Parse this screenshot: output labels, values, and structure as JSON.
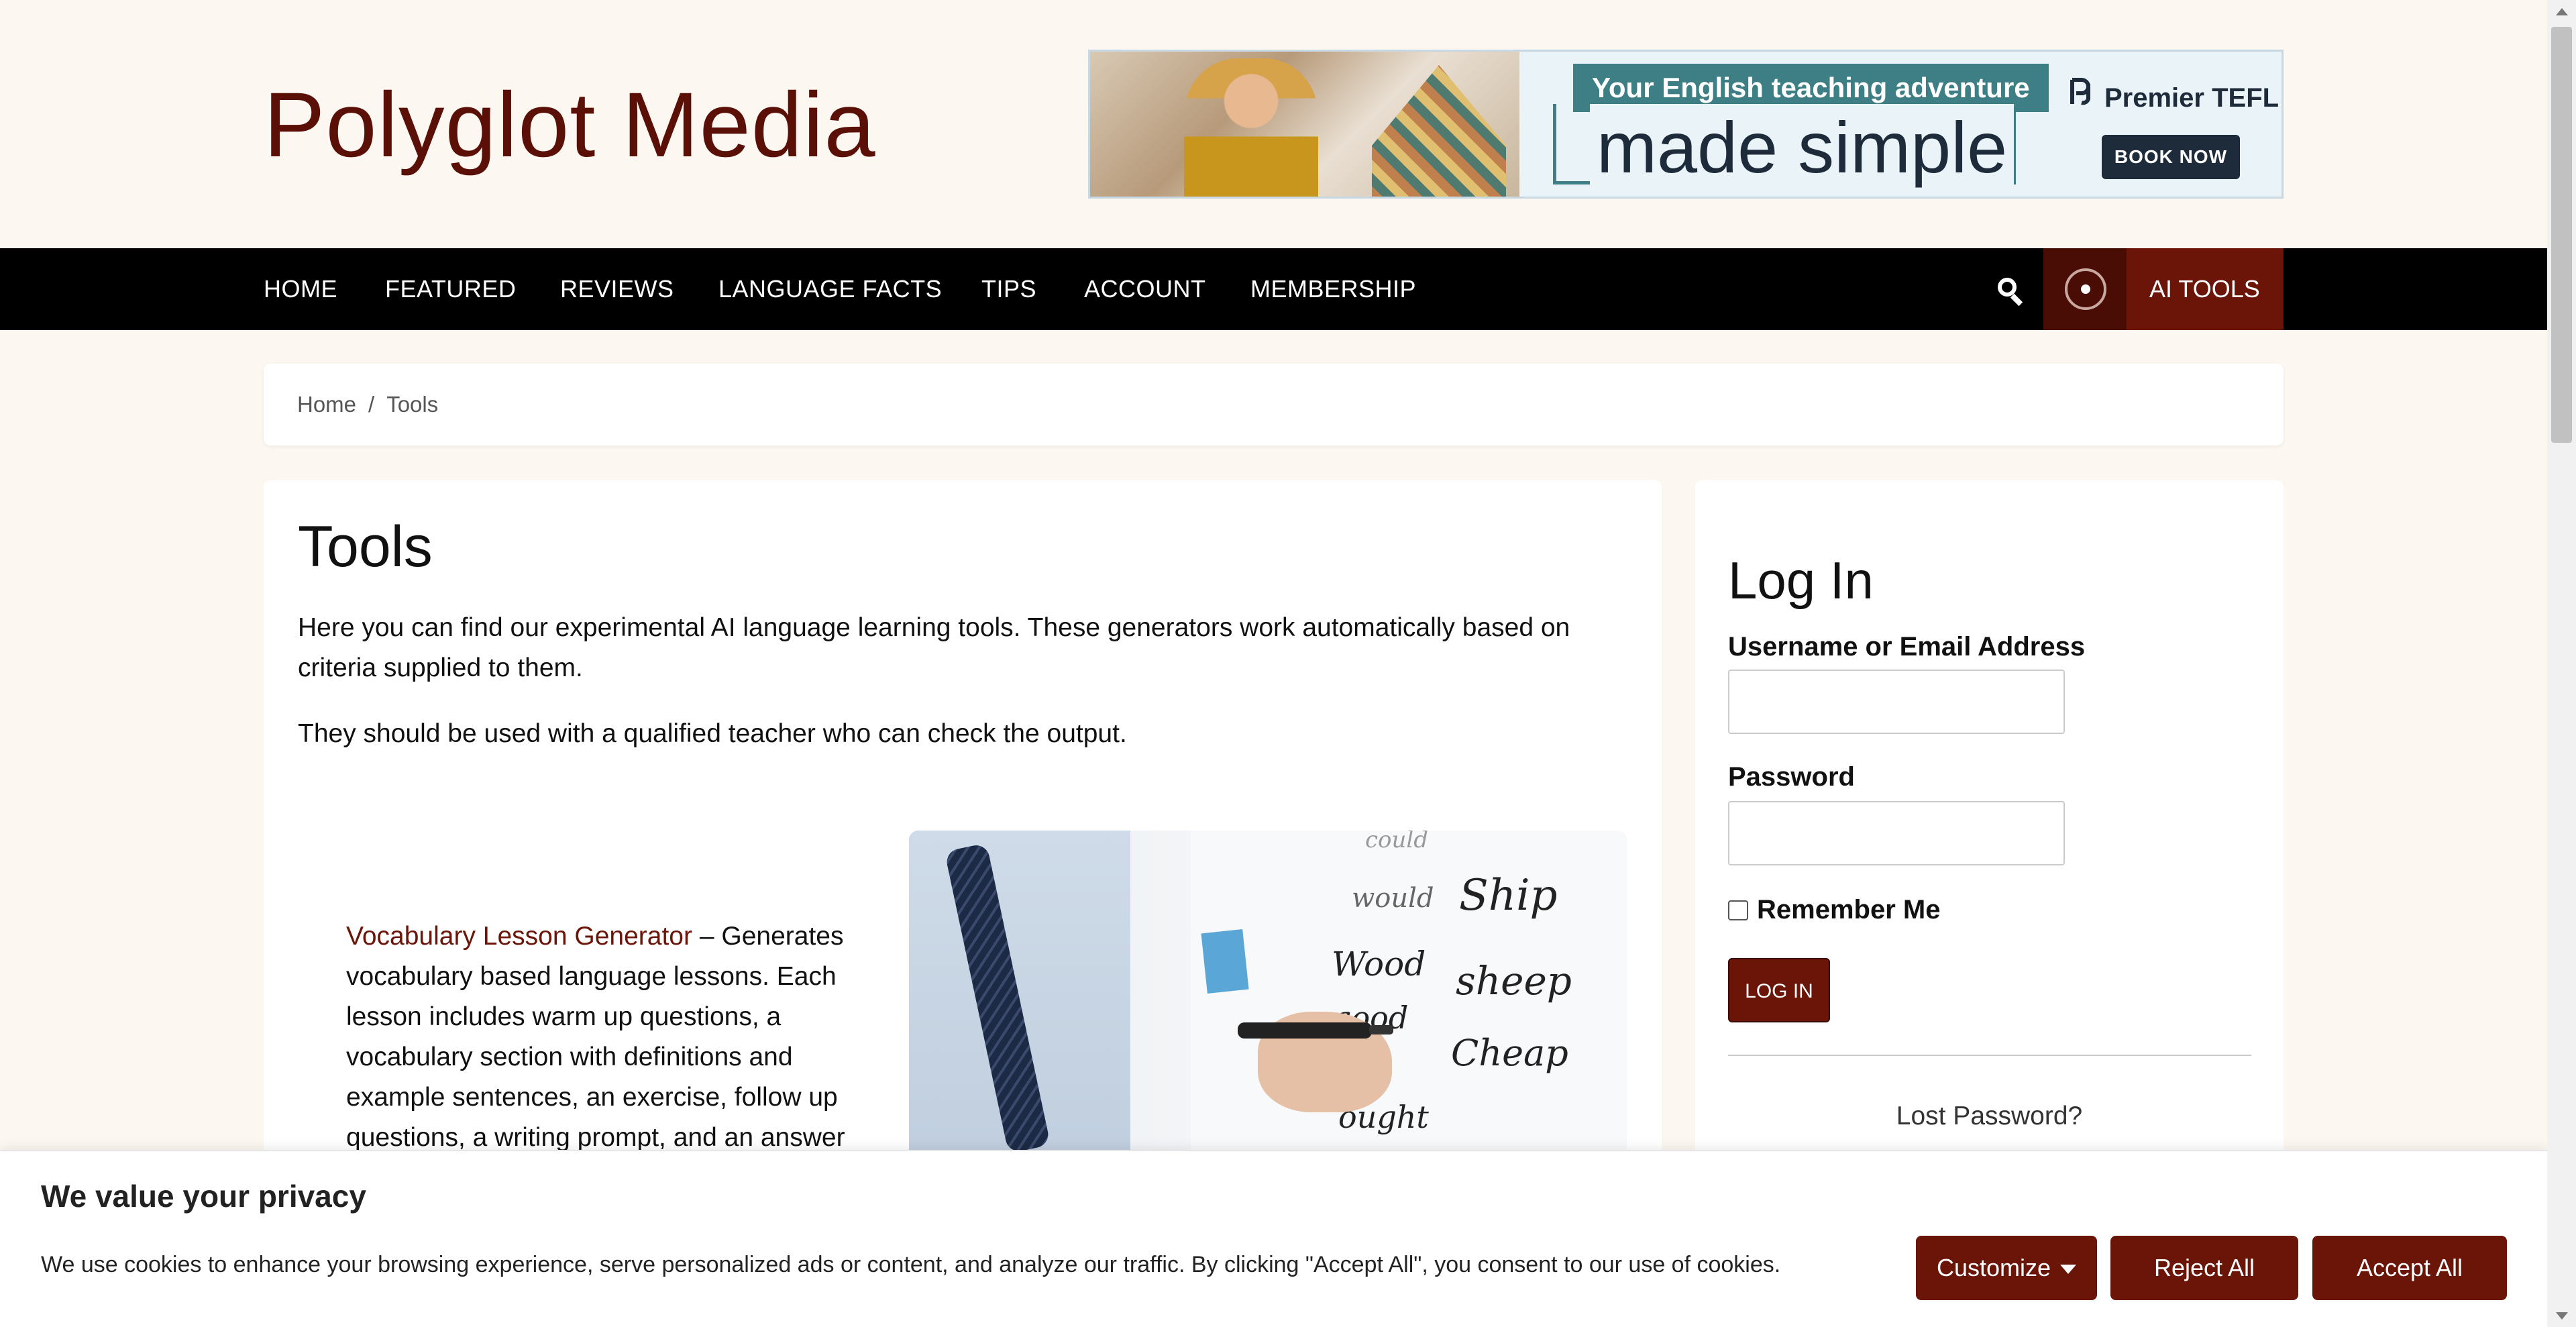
{
  "header": {
    "site_title": "Polyglot Media"
  },
  "ad": {
    "headline": "Your English teaching adventure",
    "tagline": "made simple",
    "brand": "Premier TEFL",
    "brand_icon": "premier-tefl-logo",
    "cta": "BOOK NOW"
  },
  "nav": {
    "items": [
      {
        "label": "HOME"
      },
      {
        "label": "FEATURED"
      },
      {
        "label": "REVIEWS"
      },
      {
        "label": "LANGUAGE FACTS"
      },
      {
        "label": "TIPS"
      },
      {
        "label": "ACCOUNT"
      },
      {
        "label": "MEMBERSHIP"
      }
    ],
    "search_icon": "search-icon",
    "ai_label": "AI TOOLS",
    "ai_toggle_icon": "toggle-icon"
  },
  "breadcrumb": {
    "home": "Home",
    "separator": "/",
    "current": "Tools"
  },
  "main": {
    "title": "Tools",
    "intro": "Here you can find our experimental AI language learning tools. These generators work automatically based on criteria supplied to them.",
    "intro2": "They should be used with a qualified teacher who can check the output.",
    "tool": {
      "link_text": "Vocabulary Lesson Generator",
      "description": " – Generates vocabulary based language lessons. Each lesson includes warm up questions, a vocabulary section with definitions and example sentences, an exercise, follow up questions, a writing prompt, and an answer"
    },
    "board_words": [
      "could",
      "would",
      "Wood",
      "good",
      "ought",
      "Ship",
      "sheep",
      "Cheap"
    ]
  },
  "sidebar": {
    "title": "Log In",
    "username_label": "Username or Email Address",
    "password_label": "Password",
    "remember_label": "Remember Me",
    "login_button": "LOG IN",
    "lost_password": "Lost Password?"
  },
  "cookie": {
    "title": "We value your privacy",
    "text": "We use cookies to enhance your browsing experience, serve personalized ads or content, and analyze our traffic. By clicking \"Accept All\", you consent to our use of cookies.",
    "customize": "Customize",
    "reject": "Reject All",
    "accept": "Accept All"
  },
  "colors": {
    "brand": "#6b1408",
    "title": "#5a0f07",
    "nav_bg": "#000000",
    "page_bg": "#fcf7f1"
  }
}
